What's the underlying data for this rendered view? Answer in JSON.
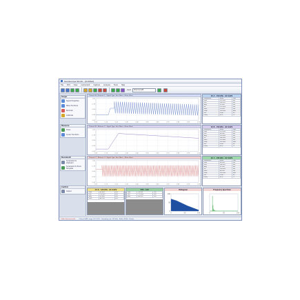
{
  "window": {
    "title": "Oscilloscope Studio - [Untitled]"
  },
  "menu": [
    "File",
    "Edit",
    "View",
    "Instrument",
    "Capture",
    "Analysis",
    "Tools",
    "Help"
  ],
  "toolbar": {
    "buttons": [
      "#4a78c8",
      "#4a78c8",
      "#3ea84a",
      "#3ea84a",
      "#d6a628",
      "#d6a628",
      "#3ea84a",
      "#c84a3a",
      "#c84a3a",
      "#3ea84a",
      "#3ea84a",
      "#8a52c0"
    ],
    "device_label": "Input",
    "device_value": "Channel A/B",
    "end_buttons": [
      "#3ea84a",
      "#c84a3a"
    ]
  },
  "sidebar": {
    "groups": [
      {
        "title": "Scope",
        "items": [
          {
            "label": "Signal Properties",
            "icon": "waveform-icon",
            "color": "#5a8ad8"
          },
          {
            "label": "Wave Functions",
            "icon": "function-icon",
            "color": "#5a8ad8"
          },
          {
            "label": "Recorder",
            "icon": "recorder-icon",
            "color": "#d65a5a"
          },
          {
            "label": "Calibrate",
            "icon": "calibrate-icon",
            "color": "#d6a628"
          }
        ]
      },
      {
        "title": "Measure",
        "items": [
          {
            "label": "Timer",
            "icon": "timer-icon",
            "color": "#4a9a58"
          },
          {
            "label": "Cursor Functions",
            "icon": "cursor-icon",
            "color": "#5a8ad8"
          }
        ]
      },
      {
        "title": "Document",
        "items": [
          {
            "label": "Screenshot to Clipboard",
            "icon": "camera-icon",
            "color": "#7a8aa8"
          },
          {
            "label": "Screenshot to Excel Template",
            "icon": "spreadsheet-icon",
            "color": "#4a9a58"
          }
        ]
      },
      {
        "title": "Control",
        "items": [
          {
            "label": "Output",
            "icon": "output-icon",
            "color": "#7a8aa8"
          }
        ]
      }
    ]
  },
  "panels": [
    {
      "header": "Channel A - Measure 1 - Signal Type: Sine Wave - Mean Value",
      "header_color": "#d3dcf4",
      "chart_data": {
        "type": "line",
        "x": [
          0,
          100
        ],
        "ylim": [
          0,
          1
        ],
        "grid": true,
        "series": [
          {
            "color": "#6e88c8",
            "segments": [
              {
                "kind": "flat",
                "x0": 0,
                "x1": 12,
                "y": 0.24
              },
              {
                "kind": "ramp",
                "x0": 12,
                "x1": 14,
                "y0": 0.24,
                "y1": 0.55
              },
              {
                "kind": "flat",
                "x0": 14,
                "x1": 18,
                "y": 0.55
              },
              {
                "kind": "osc",
                "x0": 18,
                "x1": 100,
                "ytop0": 0.86,
                "ytop1": 0.72,
                "ybot0": 0.32,
                "ybot1": 0.22,
                "cycles": 42
              }
            ]
          }
        ],
        "yticks": [
          "0.00",
          "0.25",
          "0.50",
          "0.75",
          "1.00"
        ],
        "xticks": [
          "0.00",
          "0.10",
          "0.20",
          "0.30",
          "0.40",
          "0.50",
          "0.60",
          "0.70",
          "0.80",
          "0.90",
          "1.00"
        ]
      }
    },
    {
      "header": "Channel B - Measure 2 - Signal Type: Sine Wave - Mean Value",
      "header_color": "#dcd3ee",
      "chart_data": {
        "type": "line",
        "x": [
          0,
          100
        ],
        "ylim": [
          0,
          1
        ],
        "grid": true,
        "series": [
          {
            "color": "#8e72c0",
            "segments": [
              {
                "kind": "flat",
                "x0": 0,
                "x1": 12,
                "y": 0.1
              },
              {
                "kind": "ramp",
                "x0": 12,
                "x1": 22,
                "y0": 0.1,
                "y1": 0.82
              },
              {
                "kind": "ramp",
                "x0": 22,
                "x1": 100,
                "y0": 0.82,
                "y1": 0.6
              }
            ]
          }
        ],
        "yticks": [
          "0.00",
          "0.25",
          "0.50",
          "0.75",
          "1.00"
        ],
        "xticks": [
          "0.00",
          "0.10",
          "0.20",
          "0.30",
          "0.40",
          "0.50",
          "0.60",
          "0.70",
          "0.80",
          "0.90",
          "1.00"
        ]
      }
    },
    {
      "header": "Channel C - Measure 3 - Signal Type: Sine Wave - Mean Value",
      "header_color": "#f4d0d0",
      "chart_data": {
        "type": "line",
        "x": [
          0,
          100
        ],
        "ylim": [
          0,
          1
        ],
        "grid": true,
        "series": [
          {
            "color": "#d88a8a",
            "segments": [
              {
                "kind": "flat",
                "x0": 0,
                "x1": 6,
                "y": 0.6
              },
              {
                "kind": "osc",
                "x0": 6,
                "x1": 100,
                "ytop0": 0.78,
                "ytop1": 0.78,
                "ybot0": 0.28,
                "ybot1": 0.28,
                "cycles": 62
              }
            ]
          }
        ],
        "yticks": [
          "0.00",
          "0.25",
          "0.50",
          "0.75",
          "1.00"
        ],
        "xticks": [
          "0.00",
          "0.10",
          "0.20",
          "0.30",
          "0.40",
          "0.50",
          "0.60",
          "0.70",
          "0.80",
          "0.90",
          "1.00"
        ]
      }
    }
  ],
  "tables": [
    {
      "header": "Ch A - 150 kHz - AC 0.02V",
      "header_color": "#b9d2f0",
      "rows": [
        [
          "Parameter",
          "Value",
          "Unit"
        ],
        [
          "Max",
          "125.000",
          "mV"
        ],
        [
          "Min",
          "-85.000",
          "mV"
        ],
        [
          "Avg",
          "20.000",
          "mV"
        ],
        [
          "Pk",
          "210.000",
          "mV"
        ],
        [
          "RMS",
          "76.300",
          "mV"
        ],
        [
          "Freq",
          "150.000",
          "kHz"
        ],
        [
          "Per",
          "6.667",
          "us"
        ],
        [
          "Duty",
          "50.0",
          "%"
        ]
      ]
    },
    {
      "header": "Ch B - 150 kHz - AC 0.02V",
      "header_color": "#d6ccee",
      "rows": [
        [
          "Parameter",
          "Value",
          "Unit"
        ],
        [
          "Max",
          "210.000",
          "mV"
        ],
        [
          "Min",
          "24.000",
          "mV"
        ],
        [
          "Avg",
          "150.000",
          "mV"
        ],
        [
          "Pk",
          "186.000",
          "mV"
        ],
        [
          "RMS",
          "152.400",
          "mV"
        ],
        [
          "Freq",
          "150.000",
          "kHz"
        ],
        [
          "Per",
          "6.667",
          "us"
        ],
        [
          "Duty",
          "50.0",
          "%"
        ]
      ]
    },
    {
      "header": "Ch C - 150 kHz - AC 0.02V",
      "header_color": "#9cd8a8",
      "rows": [
        [
          "Parameter",
          "Value",
          "Unit"
        ],
        [
          "Max",
          "98.000",
          "mV"
        ],
        [
          "Min",
          "-40.000",
          "mV"
        ],
        [
          "Avg",
          "30.000",
          "mV"
        ],
        [
          "Pk",
          "138.000",
          "mV"
        ],
        [
          "RMS",
          "58.900",
          "mV"
        ],
        [
          "Freq",
          "150.000",
          "kHz"
        ],
        [
          "Per",
          "6.667",
          "us"
        ],
        [
          "Duty",
          "50.0",
          "%"
        ]
      ]
    }
  ],
  "minis": [
    {
      "kind": "table",
      "header": "Ch D - 120 kHz - AC 0.02V",
      "header_color": "#efe28a",
      "rows": [
        [
          "Max",
          "80.000",
          "mV"
        ],
        [
          "Min",
          "-20.000",
          "mV"
        ],
        [
          "Avg",
          "30.000",
          "mV"
        ],
        [
          "RMS",
          "44.100",
          "mV"
        ]
      ]
    },
    {
      "kind": "table",
      "header": "CH4 - 120",
      "header_color": "#9ccfa0",
      "rows": [
        [
          "Max",
          "90.000",
          "mV"
        ],
        [
          "Min",
          "-10.000",
          "mV"
        ],
        [
          "Avg",
          "40.000",
          "mV"
        ]
      ]
    },
    {
      "kind": "chart",
      "header": "Histogram",
      "header_color": "#f2d6d6",
      "chart_data": {
        "type": "area",
        "x": [
          0,
          20,
          40,
          60,
          80,
          100
        ],
        "values": [
          70,
          60,
          45,
          30,
          18,
          6
        ],
        "ylim": [
          0,
          100
        ],
        "color": "#1f4fa0",
        "yticks": [
          "100",
          "50",
          "0"
        ],
        "xticks": [
          "0",
          "50",
          "100"
        ]
      }
    },
    {
      "kind": "chart",
      "header": "Frequency Spectrum",
      "header_color": "#f2d6d6",
      "chart_data": {
        "type": "bar",
        "x": [
          10,
          12,
          14,
          16,
          18,
          20
        ],
        "values": [
          88,
          34,
          12,
          8,
          5,
          3
        ],
        "ylim": [
          0,
          100
        ],
        "color": "#3ea84a",
        "xticks": [
          "0",
          "50",
          "100"
        ]
      }
    }
  ],
  "status": {
    "error": "Cable disconnected!",
    "info": "Channel A/B: range 20 V (DC) - Sampling rate 150 kHz - Buffer 4096 - Ready"
  }
}
